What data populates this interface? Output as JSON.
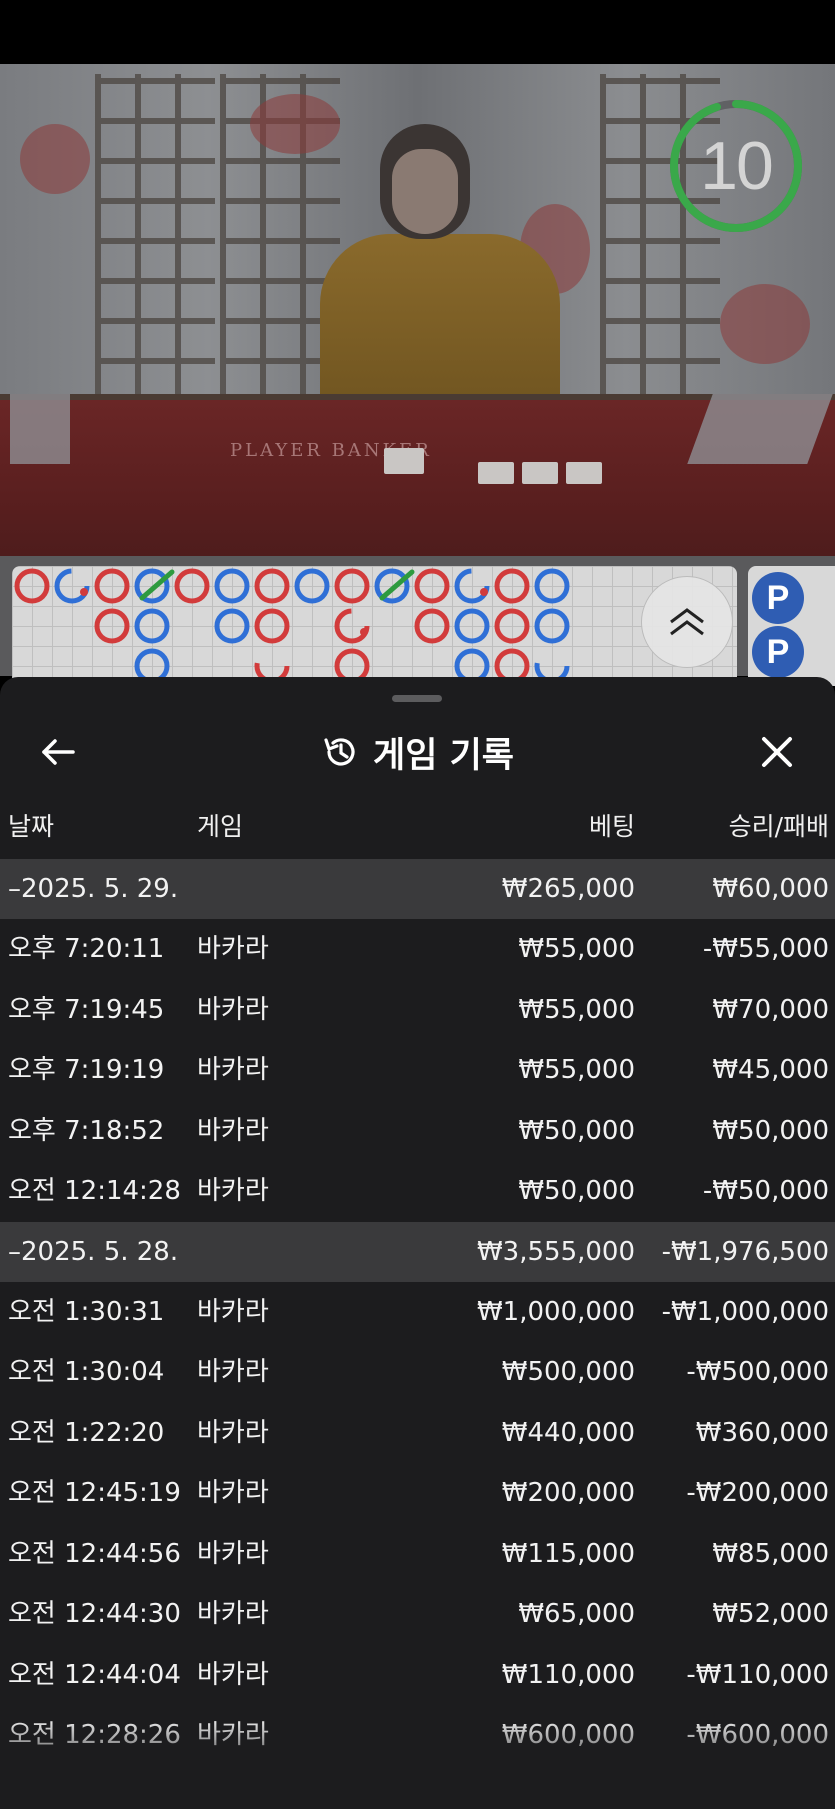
{
  "video": {
    "countdown": "10",
    "countdown_progress": 0.95,
    "table_text": "PLAYER   BANKER"
  },
  "roadmap": {
    "prediction_badges": [
      "P",
      "P"
    ],
    "scroll_icon": "double-chevron-up-icon"
  },
  "history": {
    "title": "게임 기록",
    "history_icon": "history-clock-icon",
    "back_icon": "arrow-left-icon",
    "close_icon": "close-icon",
    "columns": {
      "date": "날짜",
      "game": "게임",
      "bet": "베팅",
      "win_loss": "승리/패배"
    },
    "groups": [
      {
        "date": "–2025. 5. 29.",
        "bet": "₩265,000",
        "win_loss": "₩60,000",
        "rows": [
          {
            "time": "오후 7:20:11",
            "game": "바카라",
            "bet": "₩55,000",
            "win_loss": "-₩55,000"
          },
          {
            "time": "오후 7:19:45",
            "game": "바카라",
            "bet": "₩55,000",
            "win_loss": "₩70,000"
          },
          {
            "time": "오후 7:19:19",
            "game": "바카라",
            "bet": "₩55,000",
            "win_loss": "₩45,000"
          },
          {
            "time": "오후 7:18:52",
            "game": "바카라",
            "bet": "₩50,000",
            "win_loss": "₩50,000"
          },
          {
            "time": "오전 12:14:28",
            "game": "바카라",
            "bet": "₩50,000",
            "win_loss": "-₩50,000"
          }
        ]
      },
      {
        "date": "–2025. 5. 28.",
        "bet": "₩3,555,000",
        "win_loss": "-₩1,976,500",
        "rows": [
          {
            "time": "오전 1:30:31",
            "game": "바카라",
            "bet": "₩1,000,000",
            "win_loss": "-₩1,000,000"
          },
          {
            "time": "오전 1:30:04",
            "game": "바카라",
            "bet": "₩500,000",
            "win_loss": "-₩500,000"
          },
          {
            "time": "오전 1:22:20",
            "game": "바카라",
            "bet": "₩440,000",
            "win_loss": "₩360,000"
          },
          {
            "time": "오전 12:45:19",
            "game": "바카라",
            "bet": "₩200,000",
            "win_loss": "-₩200,000"
          },
          {
            "time": "오전 12:44:56",
            "game": "바카라",
            "bet": "₩115,000",
            "win_loss": "₩85,000"
          },
          {
            "time": "오전 12:44:30",
            "game": "바카라",
            "bet": "₩65,000",
            "win_loss": "₩52,000"
          },
          {
            "time": "오전 12:44:04",
            "game": "바카라",
            "bet": "₩110,000",
            "win_loss": "-₩110,000"
          },
          {
            "time": "오전 12:28:26",
            "game": "바카라",
            "bet": "₩600,000",
            "win_loss": "-₩600,000"
          }
        ]
      }
    ]
  },
  "colors": {
    "banker": "#d23b3b",
    "player": "#2f6fd6",
    "tie": "#2e9a3e",
    "countdown_ring": "#3aa84a"
  }
}
